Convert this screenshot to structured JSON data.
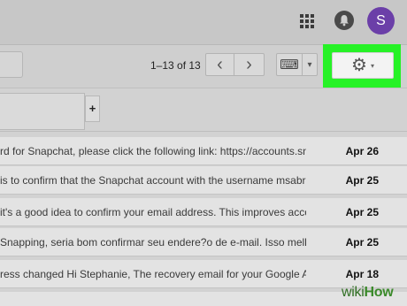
{
  "header": {
    "avatar_letter": "S",
    "icons": [
      "apps-icon",
      "notifications-bell-icon"
    ]
  },
  "toolbar": {
    "pager": "1–13 of 13",
    "prev_glyph": "‹",
    "next_glyph": "›",
    "keyboard_glyph": "⌨",
    "dropdown_glyph": "▾",
    "settings_glyph": "⚙",
    "highlight_color": "#26f226"
  },
  "tabs": {
    "add_glyph": "+"
  },
  "emails": [
    {
      "snippet": "rd for Snapchat, please click the following link: https://accounts.sn",
      "date": "Apr 26"
    },
    {
      "snippet": "is to confirm that the Snapchat account with the username msabr",
      "date": "Apr 25"
    },
    {
      "snippet": "it's a good idea to confirm your email address. This improves acco",
      "date": "Apr 25"
    },
    {
      "snippet": "Snapping, seria bom confirmar seu endere?o de e-mail. Isso melh",
      "date": "Apr 25"
    },
    {
      "snippet": "ress changed Hi Stephanie, The recovery email for your Google A",
      "date": "Apr 18"
    },
    {
      "snippet": "",
      "date": ""
    }
  ],
  "watermark": {
    "part1": "wiki",
    "part2": "How"
  }
}
